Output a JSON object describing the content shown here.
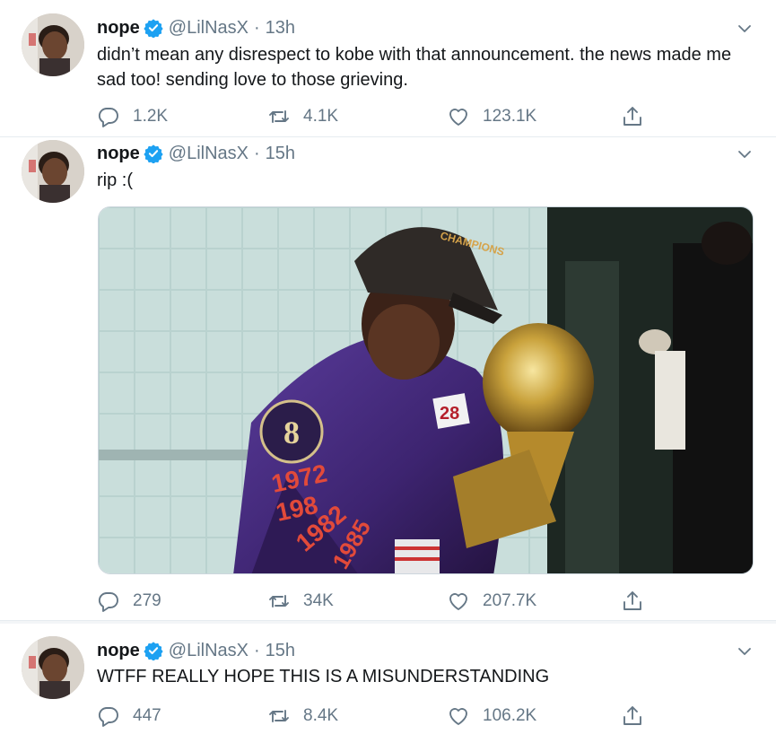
{
  "tweets": [
    {
      "name": "nope",
      "handle": "@LilNasX",
      "separator": "·",
      "time": "13h",
      "text": "didn’t mean any disrespect to kobe with that announcement. the news made me sad too! sending love to those grieving.",
      "replies": "1.2K",
      "retweets": "4.1K",
      "likes": "123.1K"
    },
    {
      "name": "nope",
      "handle": "@LilNasX",
      "separator": "·",
      "time": "15h",
      "text": "rip :(",
      "media": {
        "jacket_numbers": [
          "1972",
          "198",
          "1982",
          "1985",
          "28"
        ],
        "cap_text": "CHAMPIONS",
        "patch_text": "8"
      },
      "replies": "279",
      "retweets": "34K",
      "likes": "207.7K"
    },
    {
      "name": "nope",
      "handle": "@LilNasX",
      "separator": "·",
      "time": "15h",
      "text": "WTFF REALLY HOPE THIS IS A MISUNDERSTANDING",
      "replies": "447",
      "retweets": "8.4K",
      "likes": "106.2K"
    }
  ],
  "icons": {
    "verified": "verified-badge-icon",
    "caret": "chevron-down-icon",
    "reply": "reply-icon",
    "retweet": "retweet-icon",
    "like": "heart-icon",
    "share": "share-icon"
  },
  "colors": {
    "verified_blue": "#1da1f2",
    "meta_gray": "#657786",
    "text": "#14171a",
    "divider": "#e6ecf0"
  }
}
